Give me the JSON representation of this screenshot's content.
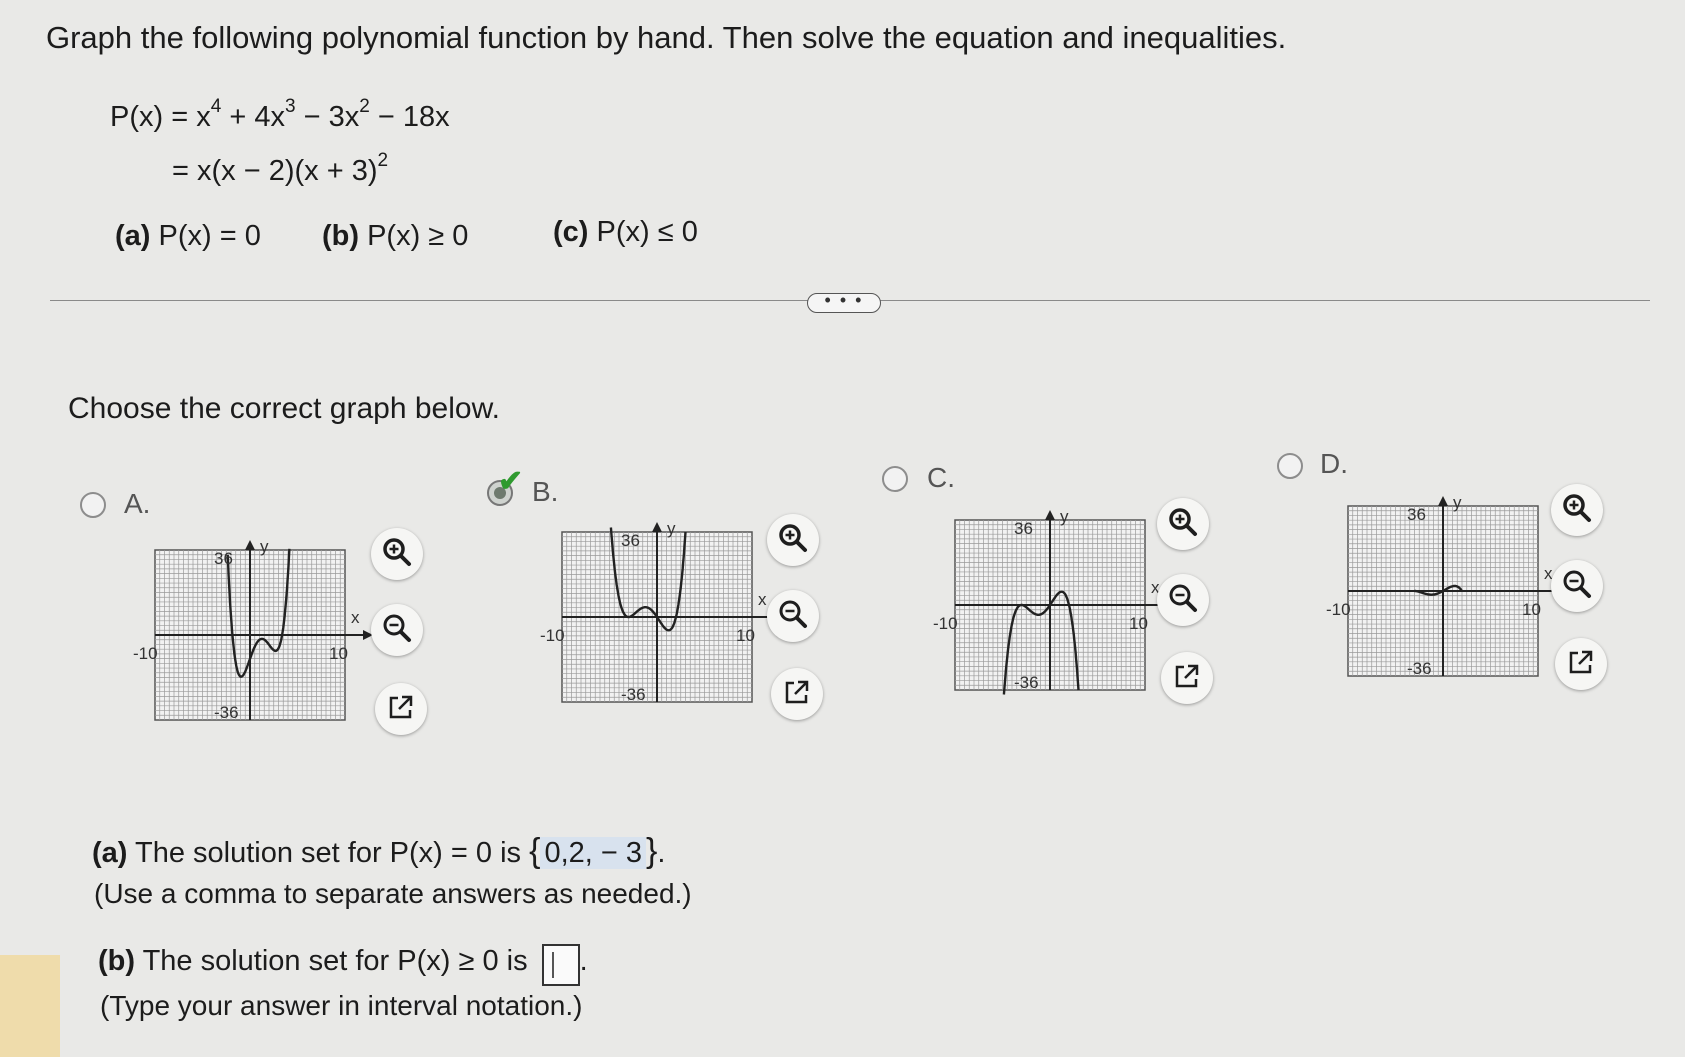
{
  "instruction": "Graph the following polynomial function by hand. Then solve the equation and inequalities.",
  "function": {
    "line1": {
      "lhs": "P(x) = x",
      "e1": "4",
      "t2": " + 4x",
      "e2": "3",
      "t3": " − 3x",
      "e3": "2",
      "t4": " − 18x"
    },
    "line2": {
      "text": "= x(x − 2)(x + 3)",
      "exp": "2"
    }
  },
  "parts": [
    {
      "label": "(a)",
      "expr": "P(x) = 0"
    },
    {
      "label": "(b)",
      "expr": "P(x) ≥ 0"
    },
    {
      "label": "(c)",
      "expr": "P(x) ≤ 0"
    }
  ],
  "more_button": "• • •",
  "prompt": "Choose the correct graph below.",
  "options": [
    {
      "letter": "A.",
      "selected": false
    },
    {
      "letter": "B.",
      "selected": true
    },
    {
      "letter": "C.",
      "selected": false
    },
    {
      "letter": "D.",
      "selected": false
    }
  ],
  "graph_labels": {
    "y": "y",
    "x": "x",
    "ymax": "36",
    "ymin": "-36",
    "xmin": "-10",
    "xmax": "10"
  },
  "answers": {
    "a": {
      "label": "(a)",
      "text": "The solution set for P(x) = 0 is",
      "value": "0,2, − 3",
      "hint": "(Use a comma to separate answers as needed.)"
    },
    "b": {
      "label": "(b)",
      "text": "The solution set for P(x) ≥ 0 is",
      "value": "",
      "hint": "(Type your answer in interval notation.)"
    }
  },
  "colors": {
    "curve": "#222222",
    "grid": "#9a9a9a",
    "check": "#2f9a2f"
  },
  "tool_icons": [
    "zoom-in-icon",
    "zoom-out-icon",
    "external-link-icon"
  ]
}
